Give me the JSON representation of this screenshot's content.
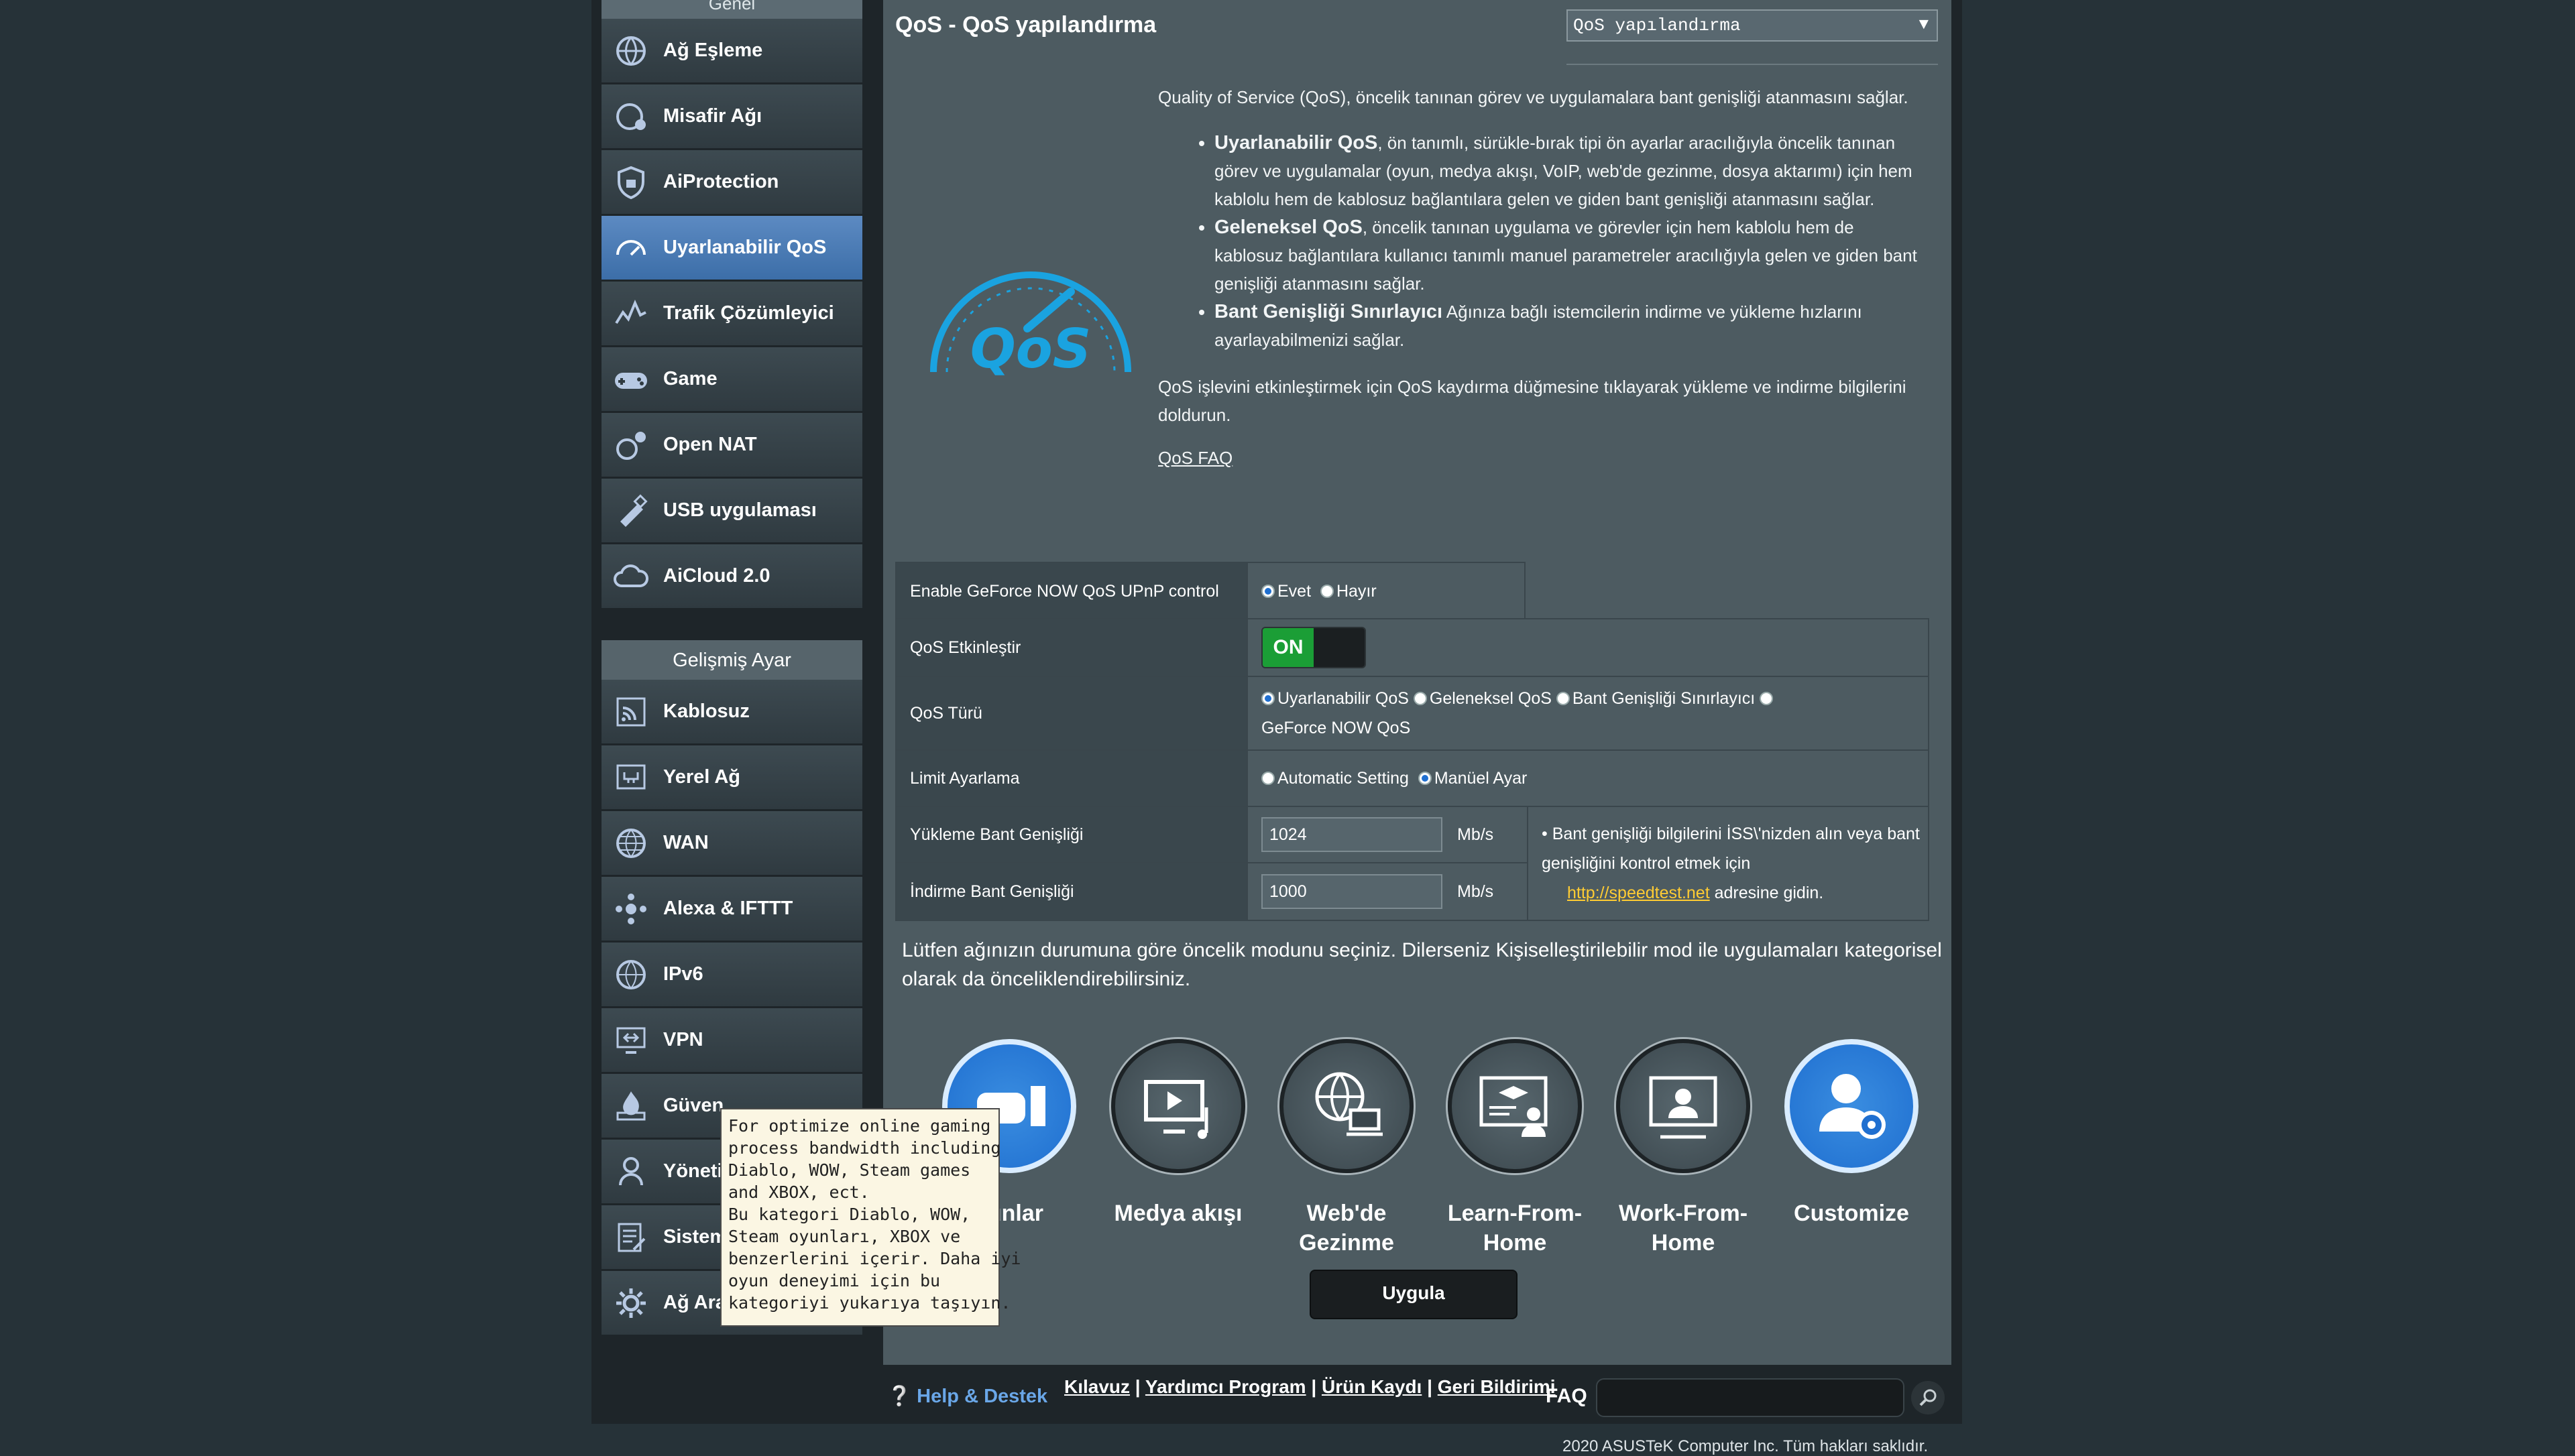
{
  "sidebar": {
    "top_group_label": "Genel",
    "items": [
      {
        "label": "Ağ Eşleme",
        "icon": "network-map-icon"
      },
      {
        "label": "Misafir Ağı",
        "icon": "guest-network-icon"
      },
      {
        "label": "AiProtection",
        "icon": "shield-icon"
      },
      {
        "label": "Uyarlanabilir QoS",
        "icon": "speedometer-icon"
      },
      {
        "label": "Trafik Çözümleyici",
        "icon": "traffic-analyzer-icon"
      },
      {
        "label": "Game",
        "icon": "gamepad-icon"
      },
      {
        "label": "Open NAT",
        "icon": "open-nat-icon"
      },
      {
        "label": "USB uygulaması",
        "icon": "usb-icon"
      },
      {
        "label": "AiCloud 2.0",
        "icon": "cloud-icon"
      }
    ],
    "advanced_header": "Gelişmiş Ayar",
    "advanced_items": [
      {
        "label": "Kablosuz",
        "icon": "wireless-icon"
      },
      {
        "label": "Yerel Ağ",
        "icon": "lan-icon"
      },
      {
        "label": "WAN",
        "icon": "globe-icon"
      },
      {
        "label": "Alexa & IFTTT",
        "icon": "alexa-icon"
      },
      {
        "label": "IPv6",
        "icon": "ipv6-icon"
      },
      {
        "label": "VPN",
        "icon": "vpn-icon"
      },
      {
        "label": "Güven",
        "icon": "firewall-icon"
      },
      {
        "label": "Yöneti",
        "icon": "administration-icon"
      },
      {
        "label": "Sistem",
        "icon": "system-log-icon"
      },
      {
        "label": "Ağ Ara",
        "icon": "network-tools-icon"
      }
    ]
  },
  "main": {
    "title": "QoS - QoS yapılandırma",
    "select_value": "QoS yapılandırma",
    "intro": "Quality of Service (QoS), öncelik tanınan görev ve uygulamalara bant genişliği atanmasını sağlar.",
    "bullets": [
      {
        "bold": "Uyarlanabilir QoS",
        "text": ", ön tanımlı, sürükle-bırak tipi ön ayarlar aracılığıyla öncelik tanınan görev ve uygulamalar (oyun, medya akışı, VoIP, web'de gezinme, dosya aktarımı) için hem kablolu hem de kablosuz bağlantılara gelen ve giden bant genişliği atanmasını sağlar."
      },
      {
        "bold": "Geleneksel QoS",
        "text": ", öncelik tanınan uygulama ve görevler için hem kablolu hem de kablosuz bağlantılara kullanıcı tanımlı manuel parametreler aracılığıyla gelen ve giden bant genişliği atanmasını sağlar."
      },
      {
        "bold": "Bant Genişliği Sınırlayıcı",
        "text": " Ağınıza bağlı istemcilerin indirme ve yükleme hızlarını ayarlayabilmenizi sağlar."
      }
    ],
    "enable_text": "QoS işlevini etkinleştirmek için QoS kaydırma düğmesine tıklayarak yükleme ve indirme bilgilerini doldurun.",
    "faq_link": "QoS FAQ"
  },
  "settings": {
    "geforce_label": "Enable GeForce NOW QoS UPnP control",
    "geforce_yes": "Evet",
    "geforce_no": "Hayır",
    "qos_enable_label": "QoS Etkinleştir",
    "toggle_on": "ON",
    "qos_type_label": "QoS Türü",
    "qos_type_options": [
      "Uyarlanabilir QoS",
      "Geleneksel QoS",
      "Bant Genişliği Sınırlayıcı",
      "GeForce NOW QoS"
    ],
    "limit_label": "Limit Ayarlama",
    "limit_auto": "Automatic Setting",
    "limit_manual": "Manüel Ayar",
    "upload_label": "Yükleme Bant Genişliği",
    "upload_value": "1024",
    "download_label": "İndirme Bant Genişliği",
    "download_value": "1000",
    "unit": "Mb/s",
    "note_text": "Bant genişliği bilgilerini İSS\\'nizden alın veya bant genişliğini kontrol etmek için",
    "note_link": "http://speedtest.net",
    "note_suffix": "adresine gidin."
  },
  "priority": {
    "text": "Lütfen ağınızın durumuna göre öncelik modunu seçiniz. Dilerseniz Kişiselleştirilebilir mod ile uygulamaları kategorisel olarak da önceliklendirebilirsiniz.",
    "modes": [
      {
        "label": "yunlar",
        "icon": "gaming-icon"
      },
      {
        "label": "Medya akışı",
        "icon": "media-streaming-icon"
      },
      {
        "label": "Web'de Gezinme",
        "icon": "web-surfing-icon"
      },
      {
        "label": "Learn-From-Home",
        "icon": "learn-from-home-icon"
      },
      {
        "label": "Work-From-Home",
        "icon": "work-from-home-icon"
      },
      {
        "label": "Customize",
        "icon": "customize-icon"
      }
    ],
    "apply": "Uygula"
  },
  "tooltip": {
    "lines": [
      "For optimize online gaming",
      "process bandwidth including",
      "Diablo, WOW, Steam games",
      "and XBOX, ect.",
      "Bu kategori Diablo, WOW,",
      "Steam oyunları, XBOX ve",
      "benzerlerini içerir. Daha iyi",
      "oyun deneyimi için bu",
      "kategoriyi yukarıya taşıyın."
    ]
  },
  "footer": {
    "help": "Help & Destek",
    "links": [
      "Kılavuz",
      "Yardımcı Program",
      "Ürün Kaydı",
      "Geri Bildirimi"
    ],
    "faq": "FAQ",
    "copyright": "2020 ASUSTeK Computer Inc. Tüm hakları saklıdır."
  },
  "colors": {
    "accent": "#3c6ea8",
    "toggle_on": "#1b9e36",
    "link": "#ffcc33",
    "help": "#6aa7e8"
  }
}
